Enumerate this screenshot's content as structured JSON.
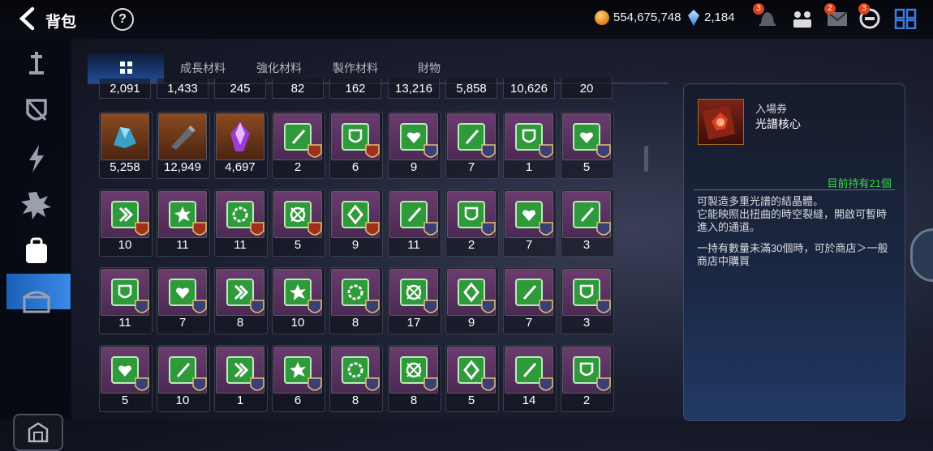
{
  "header": {
    "title": "背包",
    "help_label": "?",
    "gold_amount": "554,675,748",
    "gem_amount": "2,184",
    "badges": [
      "3",
      "2",
      "3"
    ]
  },
  "tabs": [
    {
      "label": "",
      "icon": "grid-icon",
      "active": true
    },
    {
      "label": "成長材料"
    },
    {
      "label": "強化材料"
    },
    {
      "label": "製作材料"
    },
    {
      "label": "財物"
    }
  ],
  "inventory": {
    "top_counts": [
      "2,091",
      "1,433",
      "245",
      "82",
      "162",
      "13,216",
      "5,858",
      "10,626",
      "20"
    ],
    "rows": [
      [
        {
          "count": "5,258",
          "icon": "crystal-shard-icon"
        },
        {
          "count": "12,949",
          "icon": "stone-slab-icon"
        },
        {
          "count": "4,697",
          "icon": "purple-crystal-icon"
        },
        {
          "count": "2",
          "icon": "sword-book-icon"
        },
        {
          "count": "6",
          "icon": "shield-book-icon"
        },
        {
          "count": "9",
          "icon": "heart-book-icon"
        },
        {
          "count": "7",
          "icon": "sword-book-icon"
        },
        {
          "count": "1",
          "icon": "shield-book-icon"
        },
        {
          "count": "5",
          "icon": "heart-book-icon"
        }
      ],
      [
        {
          "count": "10",
          "icon": "arrow-book-icon"
        },
        {
          "count": "11",
          "icon": "burst-book-icon"
        },
        {
          "count": "11",
          "icon": "gear-book-icon"
        },
        {
          "count": "5",
          "icon": "target-book-icon"
        },
        {
          "count": "9",
          "icon": "diamond-book-icon"
        },
        {
          "count": "11",
          "icon": "sword-book-icon"
        },
        {
          "count": "2",
          "icon": "shield-book-icon"
        },
        {
          "count": "7",
          "icon": "heart-book-icon"
        },
        {
          "count": "3",
          "icon": "sword-book-icon"
        }
      ],
      [
        {
          "count": "11",
          "icon": "shield-book-icon"
        },
        {
          "count": "7",
          "icon": "heart-book-icon"
        },
        {
          "count": "8",
          "icon": "arrow-book-icon"
        },
        {
          "count": "10",
          "icon": "burst-book-icon"
        },
        {
          "count": "8",
          "icon": "gear-book-icon"
        },
        {
          "count": "17",
          "icon": "target-book-icon"
        },
        {
          "count": "9",
          "icon": "diamond-book-icon"
        },
        {
          "count": "7",
          "icon": "sword-book-icon"
        },
        {
          "count": "3",
          "icon": "shield-book-icon"
        }
      ],
      [
        {
          "count": "5",
          "icon": "heart-book-icon"
        },
        {
          "count": "10",
          "icon": "sword-book-icon"
        },
        {
          "count": "1",
          "icon": "arrow-book-icon"
        },
        {
          "count": "6",
          "icon": "burst-book-icon"
        },
        {
          "count": "8",
          "icon": "gear-book-icon"
        },
        {
          "count": "8",
          "icon": "target-book-icon"
        },
        {
          "count": "5",
          "icon": "diamond-book-icon"
        },
        {
          "count": "14",
          "icon": "sword-book-icon"
        },
        {
          "count": "2",
          "icon": "shield-book-icon"
        }
      ]
    ]
  },
  "detail": {
    "type": "入場券",
    "name": "光譜核心",
    "holding": "目前持有21個",
    "description": "可製造多重光譜的結晶體。\n它能映照出扭曲的時空裂縫，開啟可暫時進入的通道。",
    "note": "一持有數量未滿30個時，可於商店＞一般商店中購買"
  },
  "colors": {
    "accent": "#2f7fe0",
    "holding_green": "#3fd64a",
    "slot_purple": "#5a3260",
    "book_green": "#2e9a3a"
  }
}
